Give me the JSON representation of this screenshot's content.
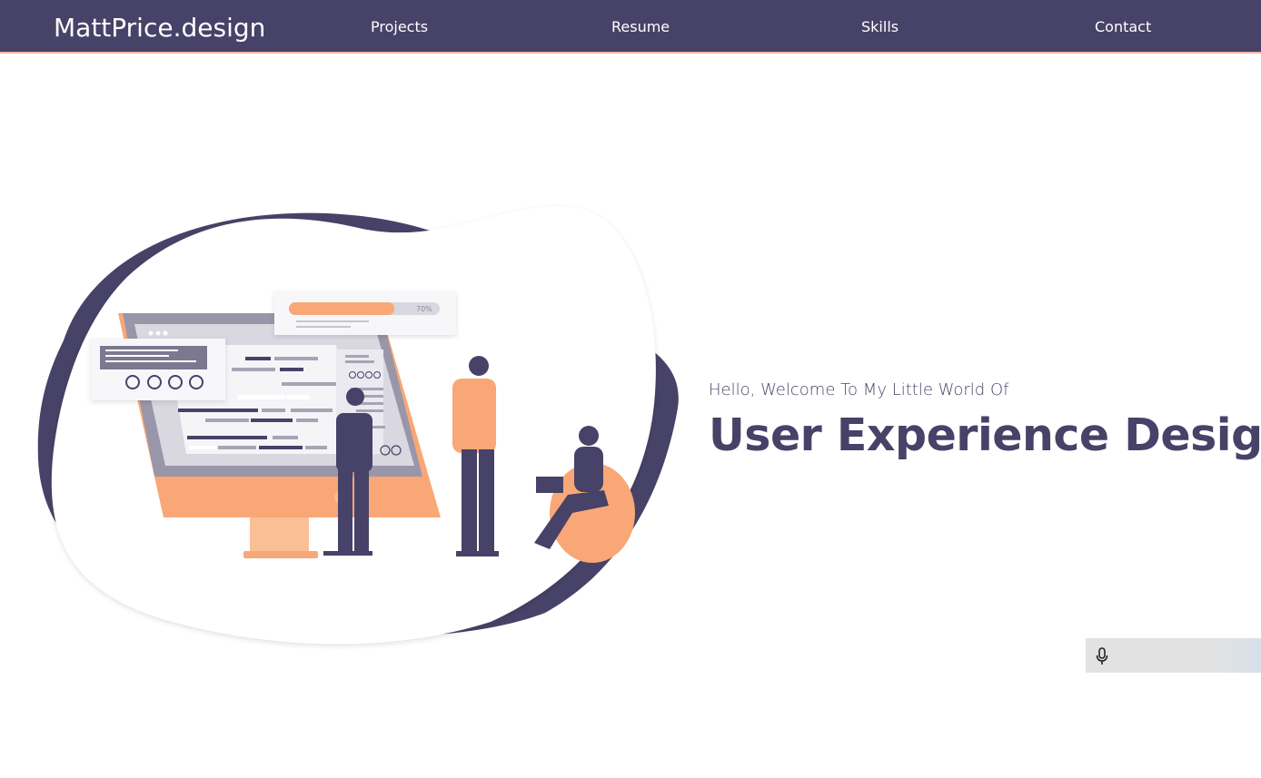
{
  "header": {
    "brand": "MattPrice.design",
    "nav": [
      {
        "label": "Projects"
      },
      {
        "label": "Resume"
      },
      {
        "label": "Skills"
      },
      {
        "label": "Contact"
      }
    ]
  },
  "hero": {
    "welcome": "Hello, Welcome To My Little World Of",
    "headline": "User Experience Design!",
    "illustration": {
      "progress_label": "70%",
      "progress_value": 0.7
    }
  },
  "widgets": {
    "voice_icon": "microphone-icon"
  },
  "colors": {
    "primary": "#474267",
    "accent": "#f9a776",
    "nav_border": "#f2b3a3",
    "background": "#ffffff"
  }
}
